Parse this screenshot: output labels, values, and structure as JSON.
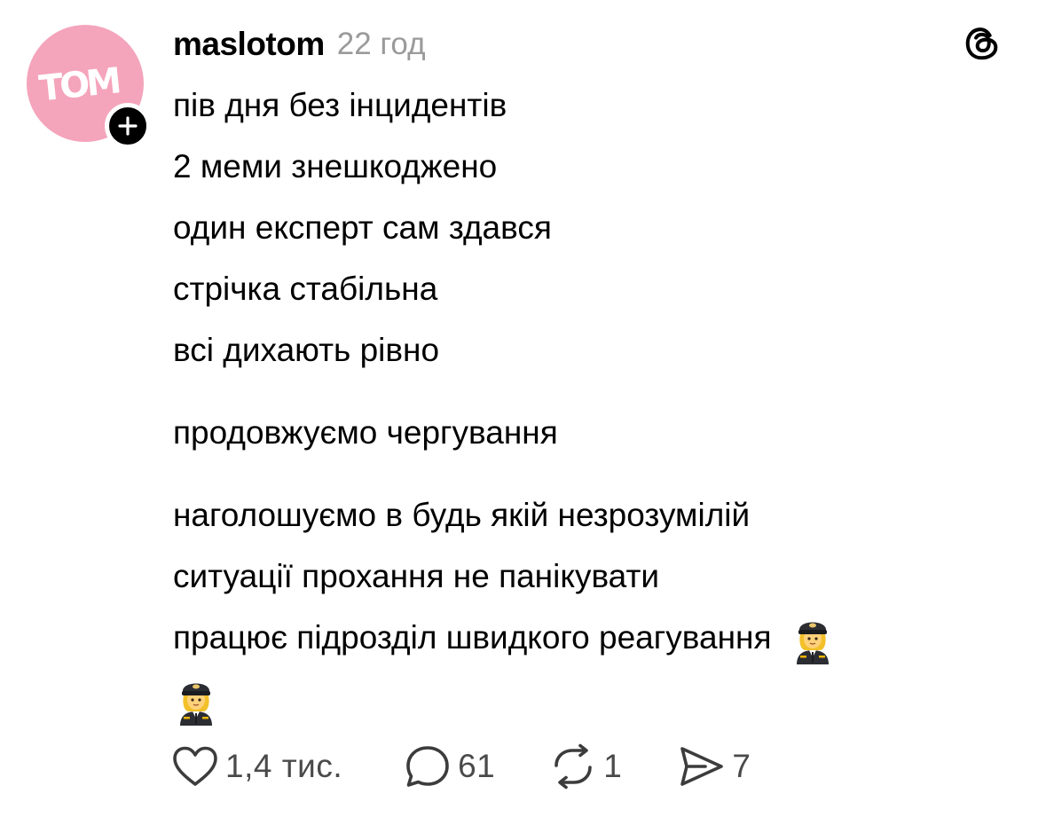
{
  "post": {
    "username": "maslotom",
    "timestamp": "22 год",
    "avatar_text": "TOM",
    "lines": [
      "пів дня без інцидентів",
      "2 меми знешкоджено",
      "один експерт сам здався",
      "стрічка стабільна",
      "всі дихають рівно",
      "продовжуємо чергування",
      "наголошуємо в будь якій незрозумілій",
      "ситуації прохання не панікувати",
      "працює підрозділ швидкого реагування"
    ]
  },
  "actions": {
    "likes": "1,4 тис.",
    "replies": "61",
    "reposts": "1",
    "shares": "7"
  },
  "icons": {
    "follow": "plus-icon",
    "app": "threads-logo-icon",
    "like": "heart-icon",
    "reply": "comment-icon",
    "repost": "repost-icon",
    "share": "send-icon",
    "emoji": "woman-pilot-emoji"
  },
  "colors": {
    "avatar_bg": "#f4a4bb",
    "muted_text": "#9a9a9a",
    "count_text": "#4a4a4a"
  }
}
